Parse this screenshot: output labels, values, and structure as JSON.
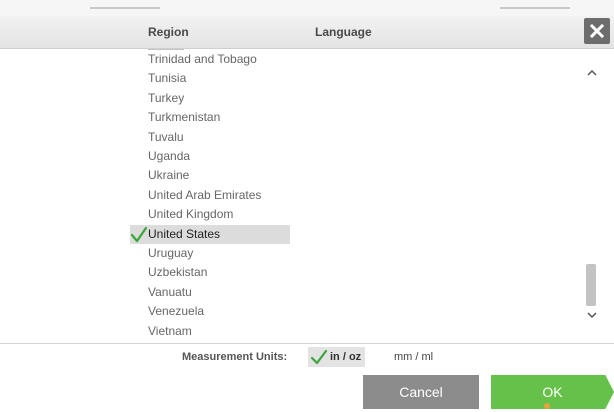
{
  "header": {
    "region_label": "Region",
    "language_label": "Language"
  },
  "regions": {
    "items": [
      "Trinidad and Tobago",
      "Tunisia",
      "Turkey",
      "Turkmenistan",
      "Tuvalu",
      "Uganda",
      "Ukraine",
      "United Arab Emirates",
      "United Kingdom",
      "United States",
      "Uruguay",
      "Uzbekistan",
      "Vanuatu",
      "Venezuela",
      "Vietnam"
    ],
    "selected": "United States"
  },
  "units": {
    "label": "Measurement Units:",
    "options": [
      "in / oz",
      "mm / ml"
    ],
    "selected": "in / oz"
  },
  "buttons": {
    "cancel": "Cancel",
    "ok": "OK"
  },
  "icons": {
    "close": "close-icon",
    "check": "checkmark-icon",
    "scroll_up": "chevron-up-icon",
    "scroll_down": "chevron-down-icon"
  },
  "colors": {
    "ok_green": "#66c14a",
    "cancel_gray": "#8c8c8c",
    "check_green": "#3aa63a",
    "close_gray": "#6d6d6d"
  }
}
